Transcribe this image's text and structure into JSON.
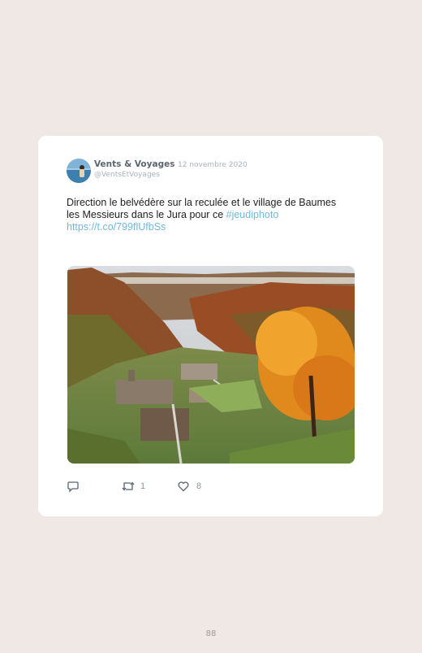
{
  "tweet": {
    "author_name": "Vents & Voyages",
    "separator": "·",
    "date": "12 novembre 2020",
    "handle": "@VentsEtVoyages",
    "text_line1": "Direction le belvédère sur la reculée et le village de Baumes",
    "text_line2_prefix": "les Messieurs dans le Jura pour ce ",
    "hashtag": "#jeudiphoto",
    "link": "https://t.co/799flUfbSs",
    "icons": {
      "avatar": "avatar-image",
      "reply": "reply-icon",
      "retweet": "retweet-icon",
      "like": "heart-icon"
    },
    "retweet_count": "1",
    "like_count": "8"
  },
  "page": {
    "number": "88"
  },
  "colors": {
    "background": "#efe8e4",
    "card": "#ffffff",
    "link": "#72b8dc",
    "meta": "#a8b3bd"
  }
}
